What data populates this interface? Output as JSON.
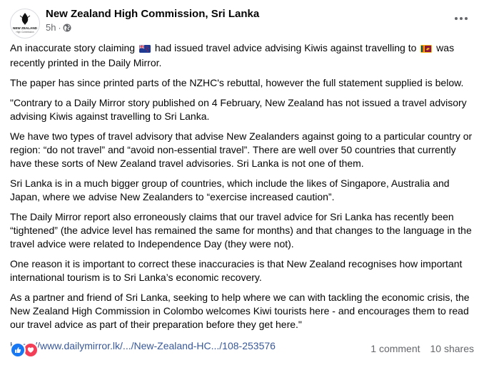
{
  "header": {
    "page_name": "New Zealand High Commission, Sri Lanka",
    "timestamp": "5h",
    "separator": "·",
    "avatar_text_top": "NEW ZEALAND",
    "avatar_text_bottom": "High Commission"
  },
  "post": {
    "intro_before_flag1": "An inaccurate story claiming",
    "intro_between_flags": "had issued travel advice advising Kiwis against travelling to",
    "intro_after_flag2": "was recently printed in the Daily Mirror.",
    "paragraphs": [
      "The paper has since printed parts of the NZHC's rebuttal, however the full statement supplied is below.",
      "\"Contrary to a Daily Mirror story published on 4 February, New Zealand has not issued a travel advisory advising Kiwis against travelling to Sri Lanka.",
      "We have two types of travel advisory that advise New Zealanders against going to a particular country or region: “do not travel” and “avoid non-essential travel”. There are well over 50 countries that currently have these sorts of New Zealand travel advisories. Sri Lanka is not one of them.",
      "Sri Lanka is in a much bigger group of countries, which include the likes of Singapore, Australia and Japan, where we advise New Zealanders to “exercise increased caution”.",
      "The Daily Mirror report also erroneously claims that our travel advice for Sri Lanka has recently been “tightened” (the advice level has remained the same for months) and that changes to the language in the travel advice were related to Independence Day (they were not).",
      "One reason it is important to correct these inaccuracies is that New Zealand recognises how important international tourism is to Sri Lanka’s economic recovery.",
      "As a partner and friend of Sri Lanka, seeking to help where we can with tackling the economic crisis, the New Zealand High Commission in Colombo welcomes Kiwi tourists here - and encourages them to read our travel advice as part of their preparation before they get here.\""
    ],
    "link_text": "https://www.dailymirror.lk/.../New-Zealand-HC.../108-253576"
  },
  "footer": {
    "comments": "1 comment",
    "shares": "10 shares"
  },
  "colors": {
    "link": "#385898",
    "meta": "#65676b",
    "like": "#1877f2",
    "love": "#f33e58"
  },
  "icons": [
    "nz-flag-icon",
    "sri-lanka-flag-icon",
    "globe-icon",
    "more-options-icon",
    "like-reaction-icon",
    "love-reaction-icon"
  ]
}
